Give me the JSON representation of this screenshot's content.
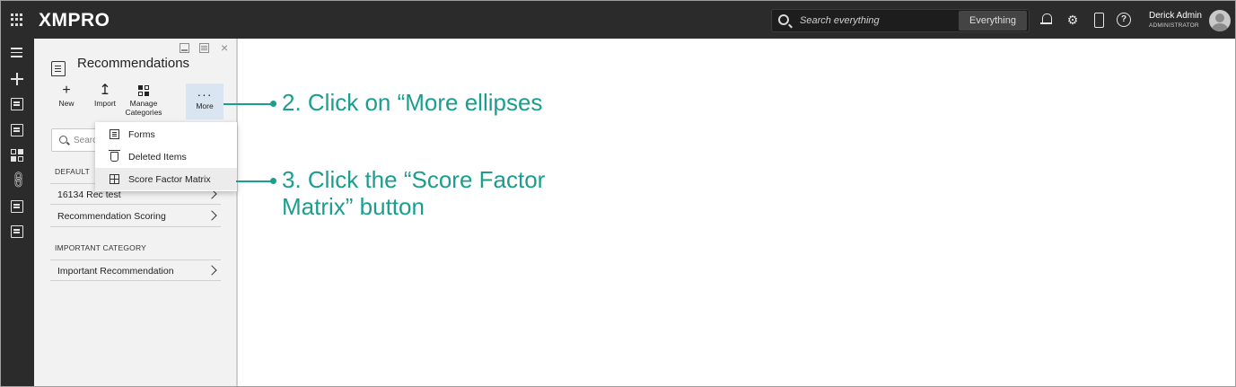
{
  "topbar": {
    "brand": "XMPRO",
    "search_placeholder": "Search everything",
    "search_scope": "Everything",
    "help_glyph": "?",
    "user_name": "Derick Admin",
    "user_role": "ADMINISTRATOR"
  },
  "panel": {
    "title": "Recommendations",
    "close_glyph": "×",
    "toolbar": {
      "new": "New",
      "import": "Import",
      "manage_categories": "Manage Categories",
      "more": "More"
    },
    "search_placeholder": "Searc",
    "sections": [
      {
        "header": "DEFAULT",
        "items": [
          "16134 Rec test",
          "Recommendation Scoring"
        ]
      },
      {
        "header": "IMPORTANT CATEGORY",
        "items": [
          "Important Recommendation"
        ]
      }
    ]
  },
  "dropdown": {
    "items": [
      "Forms",
      "Deleted Items",
      "Score Factor Matrix"
    ]
  },
  "annotations": {
    "step2": "2. Click on “More ellipses",
    "step3": "3. Click the “Score Factor Matrix” button"
  },
  "colors": {
    "topbar_bg": "#2b2b2b",
    "panel_bg": "#f2f2f2",
    "more_highlight": "#d9e5f1",
    "annotation": "#1a9e8e"
  }
}
